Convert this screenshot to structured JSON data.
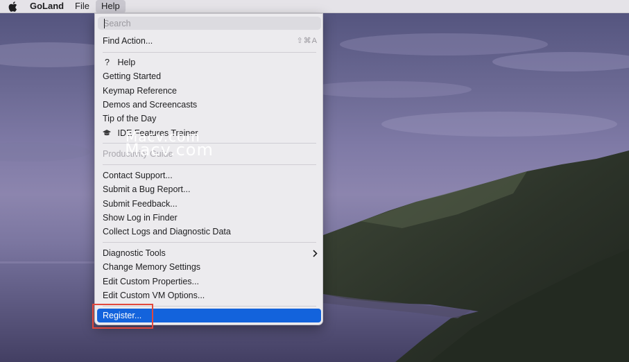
{
  "menubar": {
    "apple_icon": "apple-logo",
    "app_name": "GoLand",
    "file": "File",
    "help": "Help"
  },
  "menu": {
    "search_placeholder": "Search",
    "find_action": {
      "label": "Find Action...",
      "shortcut": "⇧⌘A"
    },
    "help": {
      "icon": "question-mark",
      "glyph": "?",
      "label": "Help"
    },
    "getting_started": "Getting Started",
    "keymap_reference": "Keymap Reference",
    "demos": "Demos and Screencasts",
    "tip_of_day": "Tip of the Day",
    "ide_features_trainer": {
      "icon": "graduation-cap",
      "label": "IDE Features Trainer"
    },
    "productivity_guide": "Productivity Guide",
    "contact_support": "Contact Support...",
    "submit_bug": "Submit a Bug Report...",
    "submit_feedback": "Submit Feedback...",
    "show_log": "Show Log in Finder",
    "collect_logs": "Collect Logs and Diagnostic Data",
    "diagnostic_tools": "Diagnostic Tools",
    "change_memory": "Change Memory Settings",
    "edit_properties": "Edit Custom Properties...",
    "edit_vm_options": "Edit Custom VM Options...",
    "register": "Register..."
  },
  "watermark": {
    "line1": "Macv.com",
    "line2": "Macv.com"
  },
  "colors": {
    "selection": "#1363dc",
    "highlight_box": "#e2483c",
    "menu_background": "#ecebee"
  }
}
